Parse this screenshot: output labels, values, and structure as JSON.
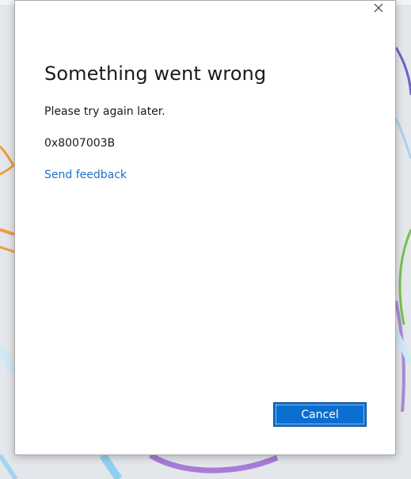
{
  "dialog": {
    "title": "Something went wrong",
    "message": "Please try again later.",
    "error_code": "0x8007003B",
    "feedback_link": "Send feedback",
    "cancel_label": "Cancel",
    "close_icon": "close-icon"
  },
  "colors": {
    "accent": "#0a6fd1",
    "link": "#1a73c8"
  }
}
